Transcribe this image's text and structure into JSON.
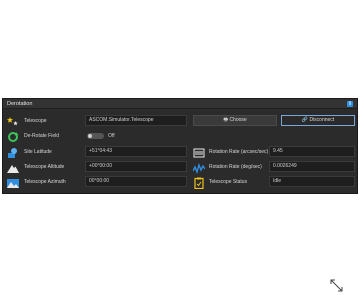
{
  "panel": {
    "title": "Derotation",
    "info_icon": "info-icon",
    "info_glyph": "i"
  },
  "rows": {
    "telescope": {
      "label": "Telescope",
      "value": "ASCOM.Simulator.Telescope",
      "choose_label": "Choose",
      "disconnect_label": "Disconnect",
      "icon": "stars-icon"
    },
    "derotate": {
      "label": "De-Rotate Field",
      "toggle_state": "Off",
      "icon": "rotate-icon"
    },
    "latitude": {
      "label": "Site Latitude",
      "value": "+51°04:43",
      "icon": "site-icon"
    },
    "altitude": {
      "label": "Telescope Altitude",
      "value": "+00°00:00",
      "icon": "mountain-icon"
    },
    "azimuth": {
      "label": "Telescope Azimuth",
      "value": "00°00:00",
      "icon": "landscape-icon"
    },
    "rate_arcsec": {
      "label": "Rotation Rate (arcsec/sec)",
      "value": "9.45",
      "icon": "gauge-icon"
    },
    "rate_deg": {
      "label": "Rotation Rate (deg/sec)",
      "value": "0.0026249",
      "icon": "wave-icon"
    },
    "status": {
      "label": "Telescope Status",
      "value": "Idle",
      "icon": "clipboard-icon"
    }
  },
  "colors": {
    "accent": "#2f8ee0",
    "panel_bg": "#2b2b2b",
    "icon_yellow": "#f0c419"
  }
}
